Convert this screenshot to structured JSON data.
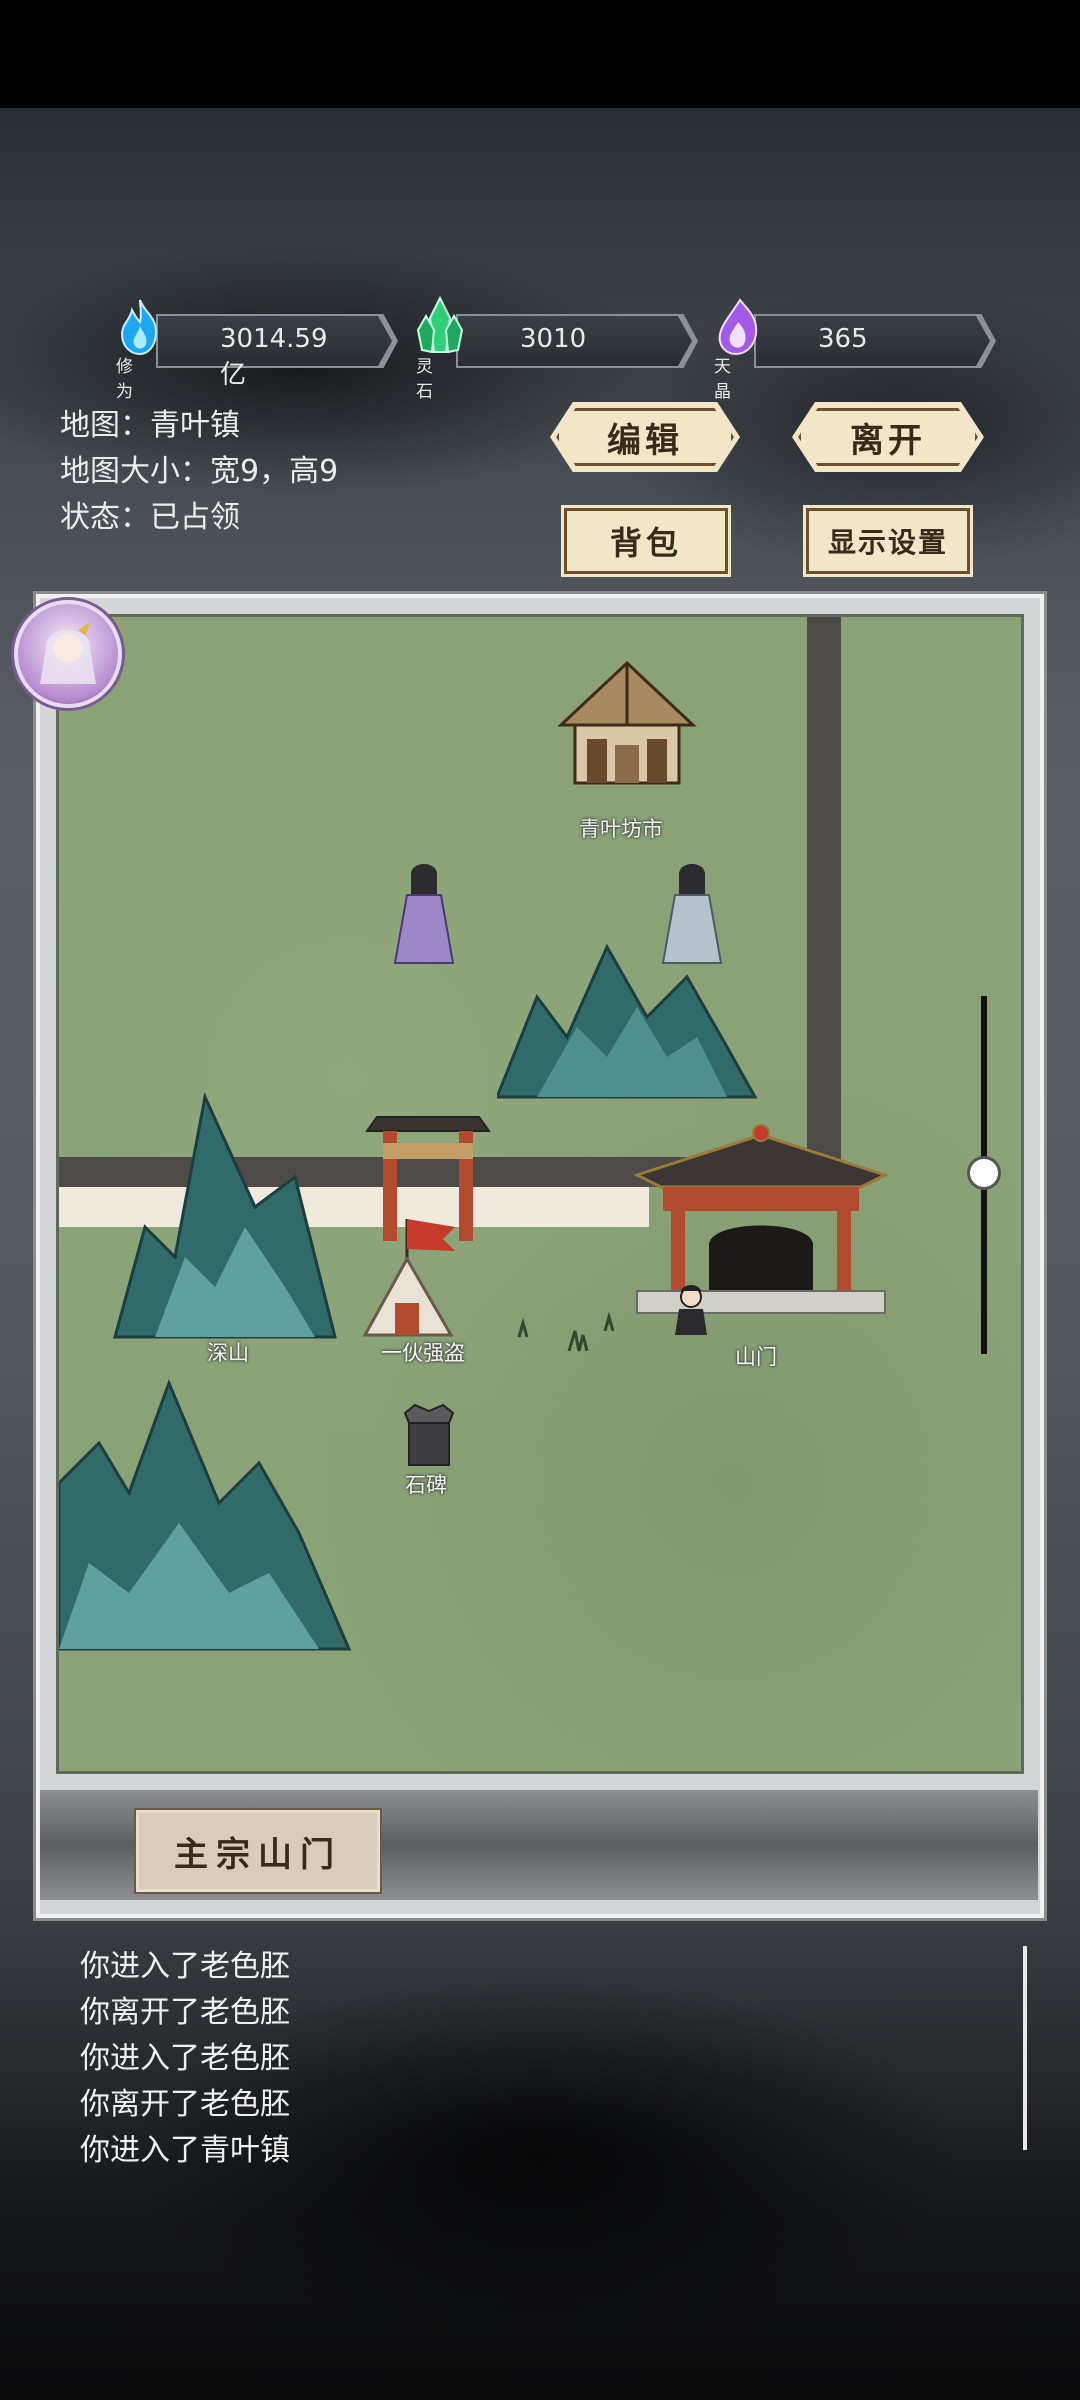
{
  "resources": [
    {
      "label": "修为",
      "value": "3014.59亿",
      "color": "#2ab7ff",
      "icon": "blue-flame-icon"
    },
    {
      "label": "灵石",
      "value": "3010",
      "color": "#2fcf78",
      "icon": "green-crystal-icon"
    },
    {
      "label": "天晶",
      "value": "365",
      "color": "#b065f0",
      "icon": "purple-flame-icon"
    }
  ],
  "map_info": {
    "name": "地图：青叶镇",
    "size": "地图大小：宽9，高9",
    "status": "状态：已占领"
  },
  "buttons": {
    "edit": "编辑",
    "leave": "离开",
    "bag": "背包",
    "display_settings": "显示设置",
    "main_sect_gate": "主宗山门"
  },
  "map_labels": {
    "market": "青叶坊市",
    "deep_mountain": "深山",
    "bandits": "一伙强盗",
    "gate": "山门",
    "stone_tablet": "石碑"
  },
  "log": [
    "你进入了老色胚",
    "你离开了老色胚",
    "你进入了老色胚",
    "你离开了老色胚",
    "你进入了青叶镇"
  ]
}
